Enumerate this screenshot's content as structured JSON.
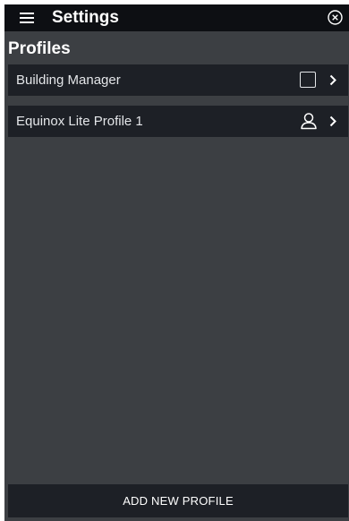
{
  "app": {
    "title": "Settings",
    "menu_icon": "hamburger-menu-icon",
    "close_icon": "close-circle-icon"
  },
  "section": {
    "title": "Profiles"
  },
  "profiles": [
    {
      "label": "Building Manager",
      "icon": "checkbox-icon",
      "chevron": "chevron-right-icon"
    },
    {
      "label": "Equinox Lite Profile 1",
      "icon": "user-icon",
      "chevron": "chevron-right-icon"
    }
  ],
  "footer": {
    "add_label": "ADD NEW PROFILE"
  },
  "colors": {
    "background": "#3c3f43",
    "topbar": "#0d0f13",
    "row": "#1d2026",
    "text": "#ffffff"
  }
}
